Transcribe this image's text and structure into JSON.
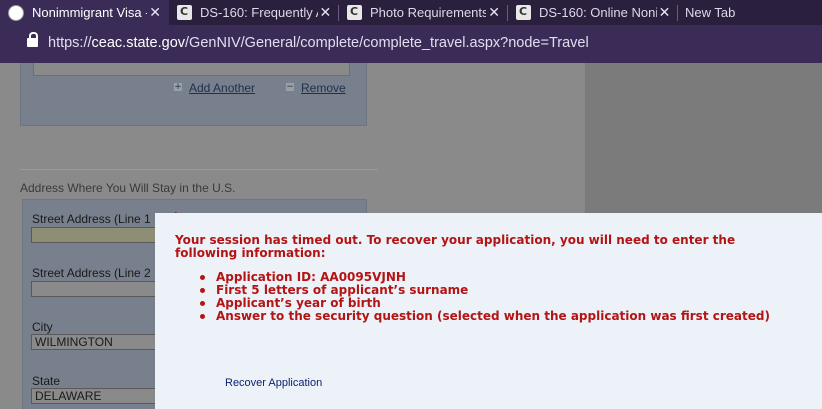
{
  "browser": {
    "tabs": [
      {
        "title": "Nonimmigrant Visa -",
        "active": true,
        "icon": "seal-favicon"
      },
      {
        "title": "DS-160: Frequently A",
        "active": false,
        "icon": "c-favicon"
      },
      {
        "title": "Photo Requirements",
        "active": false,
        "icon": "c-favicon"
      },
      {
        "title": "DS-160: Online Nonin",
        "active": false,
        "icon": "c-favicon"
      },
      {
        "title": "New Tab",
        "active": false,
        "icon": ""
      }
    ],
    "close_glyph": "✕",
    "url_scheme": "https://",
    "url_host": "ceac.state.gov",
    "url_path": "/GenNIV/General/complete/complete_travel.aspx?node=Travel"
  },
  "form": {
    "add_another": "Add Another",
    "remove": "Remove",
    "section_title": "Address Where You Will Stay in the U.S.",
    "fields": {
      "street1_label": "Street Address (Line 1",
      "street1_value": "",
      "street2_label": "Street Address (Line 2",
      "street2_value": "",
      "city_label": "City",
      "city_value": "WILMINGTON",
      "state_label": "State",
      "state_value": "DELAWARE"
    }
  },
  "modal": {
    "message": "Your session has timed out. To recover your application, you will need to enter the following information:",
    "items": [
      "Application ID: AA0095VJNH",
      "First 5 letters of applicant’s surname",
      "Applicant’s year of birth",
      "Answer to the security question (selected when the application was first created)"
    ],
    "recover_link": "Recover Application"
  },
  "colors": {
    "error_red": "#b31414",
    "link_navy": "#0c1f6e",
    "chrome_purple": "#3b2c57"
  }
}
